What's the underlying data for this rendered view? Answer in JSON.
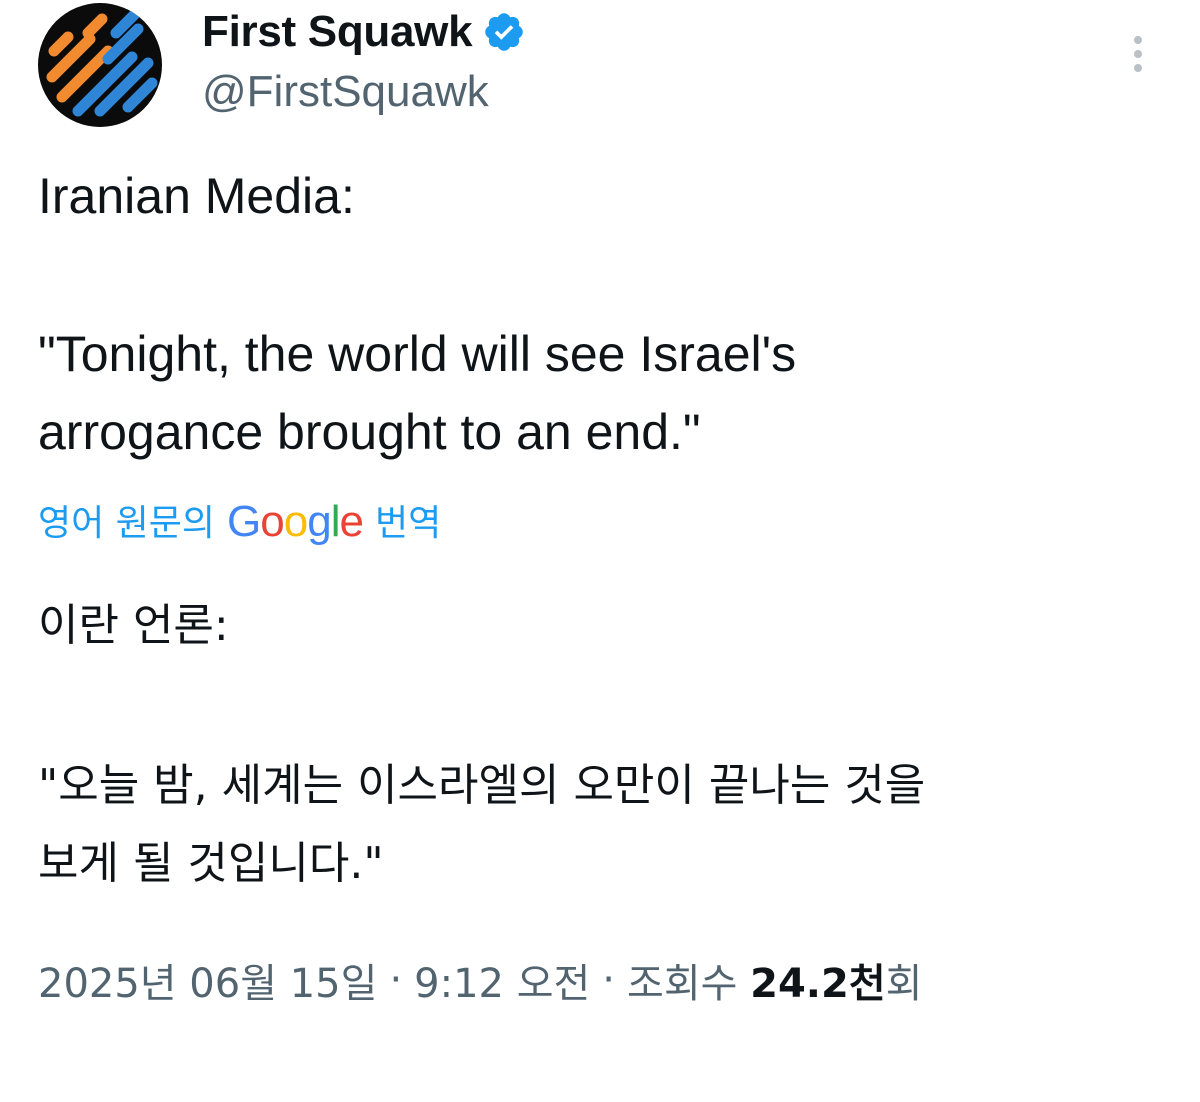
{
  "author": {
    "display_name": "First Squawk",
    "handle": "@FirstSquawk",
    "verified_icon": "verified-badge-icon",
    "avatar_icon": "first-squawk-logo"
  },
  "tweet": {
    "text_en_line1": "Iranian Media:",
    "text_en_line2": "\"Tonight, the world will see Israel's",
    "text_en_line3": "arrogance brought to an end.\""
  },
  "translation": {
    "prefix": "영어 원문의",
    "google_letters": [
      "G",
      "o",
      "o",
      "g",
      "l",
      "e"
    ],
    "google_colors": [
      "#4285F4",
      "#EA4335",
      "#FBBC05",
      "#4285F4",
      "#34A853",
      "#EA4335"
    ],
    "suffix": "번역",
    "text_ko_line1": "이란 언론:",
    "text_ko_line2": "\"오늘 밤, 세계는 이스라엘의 오만이 끝나는 것을",
    "text_ko_line3": "보게 될 것입니다.\""
  },
  "meta": {
    "date": "2025년 06월 15일",
    "separator": "·",
    "time": "9:12 오전",
    "views_label": "조회수",
    "views_count": "24.2천",
    "views_suffix": "회"
  },
  "colors": {
    "link_blue": "#1d9bf0",
    "text_primary": "#0f1419",
    "text_secondary": "#536471",
    "verified_blue": "#1d9bf0",
    "avatar_orange": "#f28a30",
    "avatar_blue": "#2f86d6"
  }
}
